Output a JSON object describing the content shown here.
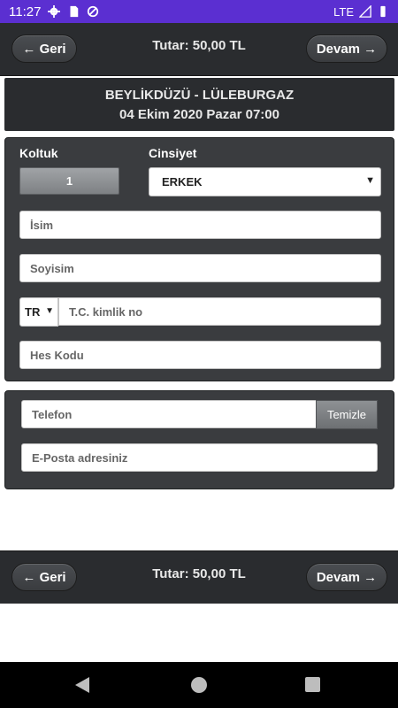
{
  "status_bar": {
    "time": "11:27",
    "network": "LTE"
  },
  "top_bar": {
    "back_label": "← Geri",
    "total": "Tutar: 50,00 TL",
    "next_label": "Devam →"
  },
  "route": {
    "line": "BEYLİKDÜZÜ - LÜLEBURGAZ",
    "datetime": "04 Ekim 2020 Pazar 07:00"
  },
  "passenger": {
    "seat_label": "Koltuk",
    "seat_value": "1",
    "gender_label": "Cinsiyet",
    "gender_value": "ERKEK",
    "first_name_placeholder": "İsim",
    "last_name_placeholder": "Soyisim",
    "country_code": "TR",
    "tc_placeholder": "T.C. kimlik no",
    "hes_placeholder": "Hes Kodu"
  },
  "contact": {
    "phone_placeholder": "Telefon",
    "clear_label": "Temizle",
    "email_placeholder": "E-Posta adresiniz"
  },
  "bottom_bar": {
    "back_label": "← Geri",
    "total": "Tutar: 50,00 TL",
    "next_label": "Devam →"
  },
  "colors": {
    "status_bar": "#5b2fd1",
    "bar_bg": "#2a2c2f",
    "panel_bg": "#3a3c3f"
  },
  "icons": [
    "settings-icon",
    "sd-card-icon",
    "data-saver-icon",
    "signal-icon",
    "battery-icon",
    "nav-back-icon",
    "nav-home-icon",
    "nav-recents-icon"
  ]
}
